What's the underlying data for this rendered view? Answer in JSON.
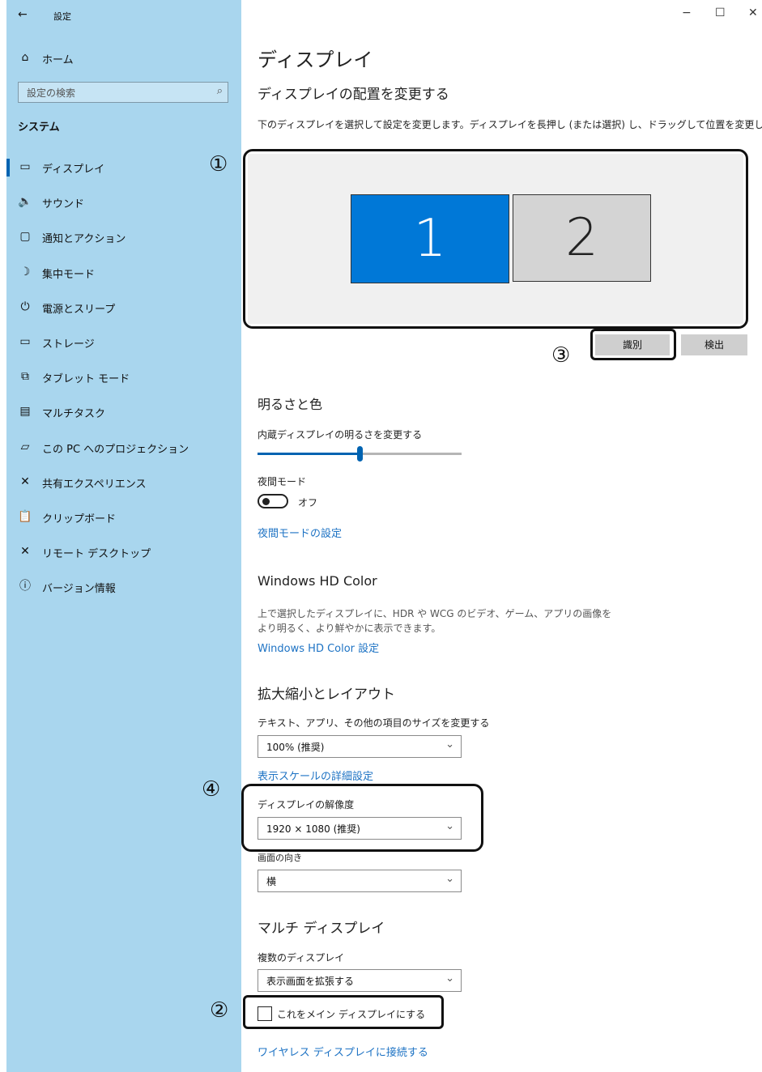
{
  "window": {
    "title": "設定",
    "back_icon": "back-arrow-icon",
    "minimize": "−",
    "maximize": "☐",
    "close": "✕"
  },
  "sidebar": {
    "home_label": "ホーム",
    "search_placeholder": "設定の検索",
    "section_title": "システム",
    "items": [
      {
        "label": "ディスプレイ",
        "icon": "monitor-icon",
        "glyph": "▭"
      },
      {
        "label": "サウンド",
        "icon": "speaker-icon",
        "glyph": "🔈"
      },
      {
        "label": "通知とアクション",
        "icon": "notification-icon",
        "glyph": "▢"
      },
      {
        "label": "集中モード",
        "icon": "moon-icon",
        "glyph": "☽"
      },
      {
        "label": "電源とスリープ",
        "icon": "power-icon",
        "glyph": "⏻"
      },
      {
        "label": "ストレージ",
        "icon": "storage-icon",
        "glyph": "▭"
      },
      {
        "label": "タブレット モード",
        "icon": "tablet-icon",
        "glyph": "⧉"
      },
      {
        "label": "マルチタスク",
        "icon": "multitask-icon",
        "glyph": "▤"
      },
      {
        "label": "この PC へのプロジェクション",
        "icon": "projection-icon",
        "glyph": "▱"
      },
      {
        "label": "共有エクスペリエンス",
        "icon": "shared-icon",
        "glyph": "✕"
      },
      {
        "label": "クリップボード",
        "icon": "clipboard-icon",
        "glyph": "📋"
      },
      {
        "label": "リモート デスクトップ",
        "icon": "remote-icon",
        "glyph": "✕"
      },
      {
        "label": "バージョン情報",
        "icon": "info-icon",
        "glyph": "ⓘ"
      }
    ]
  },
  "main": {
    "title": "ディスプレイ",
    "arrange_heading": "ディスプレイの配置を変更する",
    "arrange_desc": "下のディスプレイを選択して設定を変更します。ディスプレイを長押し (または選択) し、ドラッグして位置を変更します。",
    "monitor1": "1",
    "monitor2": "2",
    "identify_label": "識別",
    "detect_label": "検出",
    "brightness_heading": "明るさと色",
    "brightness_label": "内蔵ディスプレイの明るさを変更する",
    "brightness_level": 0.5,
    "night_label": "夜間モード",
    "night_state": "オフ",
    "night_link": "夜間モードの設定",
    "hd_heading": "Windows HD Color",
    "hd_desc_1": "上で選択したディスプレイに、HDR や WCG のビデオ、ゲーム、アプリの画像を",
    "hd_desc_2": "より明るく、より鮮やかに表示できます。",
    "hd_link": "Windows HD Color 設定",
    "scale_heading": "拡大縮小とレイアウト",
    "scale_label": "テキスト、アプリ、その他の項目のサイズを変更する",
    "scale_value": "100% (推奨)",
    "scale_link": "表示スケールの詳細設定",
    "resolution_label": "ディスプレイの解像度",
    "resolution_value": "1920 × 1080 (推奨)",
    "orientation_label": "画面の向き",
    "orientation_value": "横",
    "multi_heading": "マルチ ディスプレイ",
    "multi_label": "複数のディスプレイ",
    "multi_value": "表示画面を拡張する",
    "main_display_label": "これをメイン ディスプレイにする",
    "wireless_link": "ワイヤレス ディスプレイに接続する"
  },
  "callouts": {
    "c1": "①",
    "c2": "②",
    "c3": "③",
    "c4": "④"
  },
  "colors": {
    "sidebar": "#a9d6ee",
    "accent": "#0063b1",
    "monitor_selected": "#0078d7",
    "monitor_other": "#d4d4d4"
  }
}
